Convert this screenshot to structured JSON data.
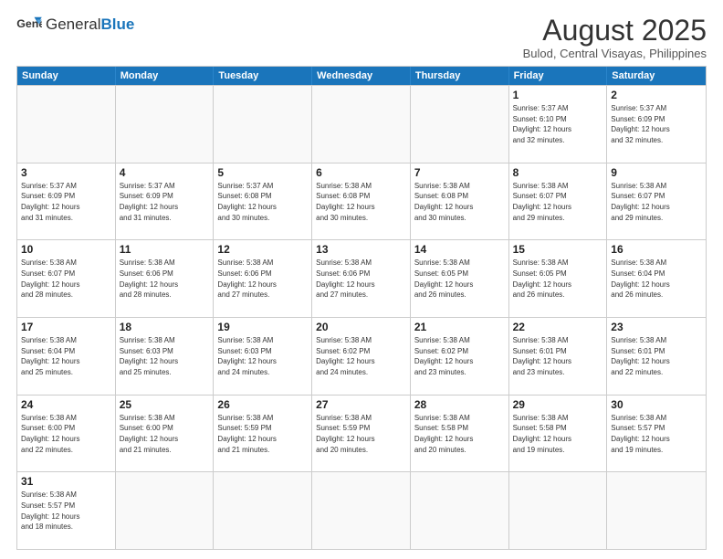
{
  "logo": {
    "text_general": "General",
    "text_blue": "Blue"
  },
  "title": "August 2025",
  "subtitle": "Bulod, Central Visayas, Philippines",
  "header_days": [
    "Sunday",
    "Monday",
    "Tuesday",
    "Wednesday",
    "Thursday",
    "Friday",
    "Saturday"
  ],
  "rows": [
    [
      {
        "day": "",
        "info": ""
      },
      {
        "day": "",
        "info": ""
      },
      {
        "day": "",
        "info": ""
      },
      {
        "day": "",
        "info": ""
      },
      {
        "day": "",
        "info": ""
      },
      {
        "day": "1",
        "info": "Sunrise: 5:37 AM\nSunset: 6:10 PM\nDaylight: 12 hours\nand 32 minutes."
      },
      {
        "day": "2",
        "info": "Sunrise: 5:37 AM\nSunset: 6:09 PM\nDaylight: 12 hours\nand 32 minutes."
      }
    ],
    [
      {
        "day": "3",
        "info": "Sunrise: 5:37 AM\nSunset: 6:09 PM\nDaylight: 12 hours\nand 31 minutes."
      },
      {
        "day": "4",
        "info": "Sunrise: 5:37 AM\nSunset: 6:09 PM\nDaylight: 12 hours\nand 31 minutes."
      },
      {
        "day": "5",
        "info": "Sunrise: 5:37 AM\nSunset: 6:08 PM\nDaylight: 12 hours\nand 30 minutes."
      },
      {
        "day": "6",
        "info": "Sunrise: 5:38 AM\nSunset: 6:08 PM\nDaylight: 12 hours\nand 30 minutes."
      },
      {
        "day": "7",
        "info": "Sunrise: 5:38 AM\nSunset: 6:08 PM\nDaylight: 12 hours\nand 30 minutes."
      },
      {
        "day": "8",
        "info": "Sunrise: 5:38 AM\nSunset: 6:07 PM\nDaylight: 12 hours\nand 29 minutes."
      },
      {
        "day": "9",
        "info": "Sunrise: 5:38 AM\nSunset: 6:07 PM\nDaylight: 12 hours\nand 29 minutes."
      }
    ],
    [
      {
        "day": "10",
        "info": "Sunrise: 5:38 AM\nSunset: 6:07 PM\nDaylight: 12 hours\nand 28 minutes."
      },
      {
        "day": "11",
        "info": "Sunrise: 5:38 AM\nSunset: 6:06 PM\nDaylight: 12 hours\nand 28 minutes."
      },
      {
        "day": "12",
        "info": "Sunrise: 5:38 AM\nSunset: 6:06 PM\nDaylight: 12 hours\nand 27 minutes."
      },
      {
        "day": "13",
        "info": "Sunrise: 5:38 AM\nSunset: 6:06 PM\nDaylight: 12 hours\nand 27 minutes."
      },
      {
        "day": "14",
        "info": "Sunrise: 5:38 AM\nSunset: 6:05 PM\nDaylight: 12 hours\nand 26 minutes."
      },
      {
        "day": "15",
        "info": "Sunrise: 5:38 AM\nSunset: 6:05 PM\nDaylight: 12 hours\nand 26 minutes."
      },
      {
        "day": "16",
        "info": "Sunrise: 5:38 AM\nSunset: 6:04 PM\nDaylight: 12 hours\nand 26 minutes."
      }
    ],
    [
      {
        "day": "17",
        "info": "Sunrise: 5:38 AM\nSunset: 6:04 PM\nDaylight: 12 hours\nand 25 minutes."
      },
      {
        "day": "18",
        "info": "Sunrise: 5:38 AM\nSunset: 6:03 PM\nDaylight: 12 hours\nand 25 minutes."
      },
      {
        "day": "19",
        "info": "Sunrise: 5:38 AM\nSunset: 6:03 PM\nDaylight: 12 hours\nand 24 minutes."
      },
      {
        "day": "20",
        "info": "Sunrise: 5:38 AM\nSunset: 6:02 PM\nDaylight: 12 hours\nand 24 minutes."
      },
      {
        "day": "21",
        "info": "Sunrise: 5:38 AM\nSunset: 6:02 PM\nDaylight: 12 hours\nand 23 minutes."
      },
      {
        "day": "22",
        "info": "Sunrise: 5:38 AM\nSunset: 6:01 PM\nDaylight: 12 hours\nand 23 minutes."
      },
      {
        "day": "23",
        "info": "Sunrise: 5:38 AM\nSunset: 6:01 PM\nDaylight: 12 hours\nand 22 minutes."
      }
    ],
    [
      {
        "day": "24",
        "info": "Sunrise: 5:38 AM\nSunset: 6:00 PM\nDaylight: 12 hours\nand 22 minutes."
      },
      {
        "day": "25",
        "info": "Sunrise: 5:38 AM\nSunset: 6:00 PM\nDaylight: 12 hours\nand 21 minutes."
      },
      {
        "day": "26",
        "info": "Sunrise: 5:38 AM\nSunset: 5:59 PM\nDaylight: 12 hours\nand 21 minutes."
      },
      {
        "day": "27",
        "info": "Sunrise: 5:38 AM\nSunset: 5:59 PM\nDaylight: 12 hours\nand 20 minutes."
      },
      {
        "day": "28",
        "info": "Sunrise: 5:38 AM\nSunset: 5:58 PM\nDaylight: 12 hours\nand 20 minutes."
      },
      {
        "day": "29",
        "info": "Sunrise: 5:38 AM\nSunset: 5:58 PM\nDaylight: 12 hours\nand 19 minutes."
      },
      {
        "day": "30",
        "info": "Sunrise: 5:38 AM\nSunset: 5:57 PM\nDaylight: 12 hours\nand 19 minutes."
      }
    ],
    [
      {
        "day": "31",
        "info": "Sunrise: 5:38 AM\nSunset: 5:57 PM\nDaylight: 12 hours\nand 18 minutes."
      },
      {
        "day": "",
        "info": ""
      },
      {
        "day": "",
        "info": ""
      },
      {
        "day": "",
        "info": ""
      },
      {
        "day": "",
        "info": ""
      },
      {
        "day": "",
        "info": ""
      },
      {
        "day": "",
        "info": ""
      }
    ]
  ]
}
